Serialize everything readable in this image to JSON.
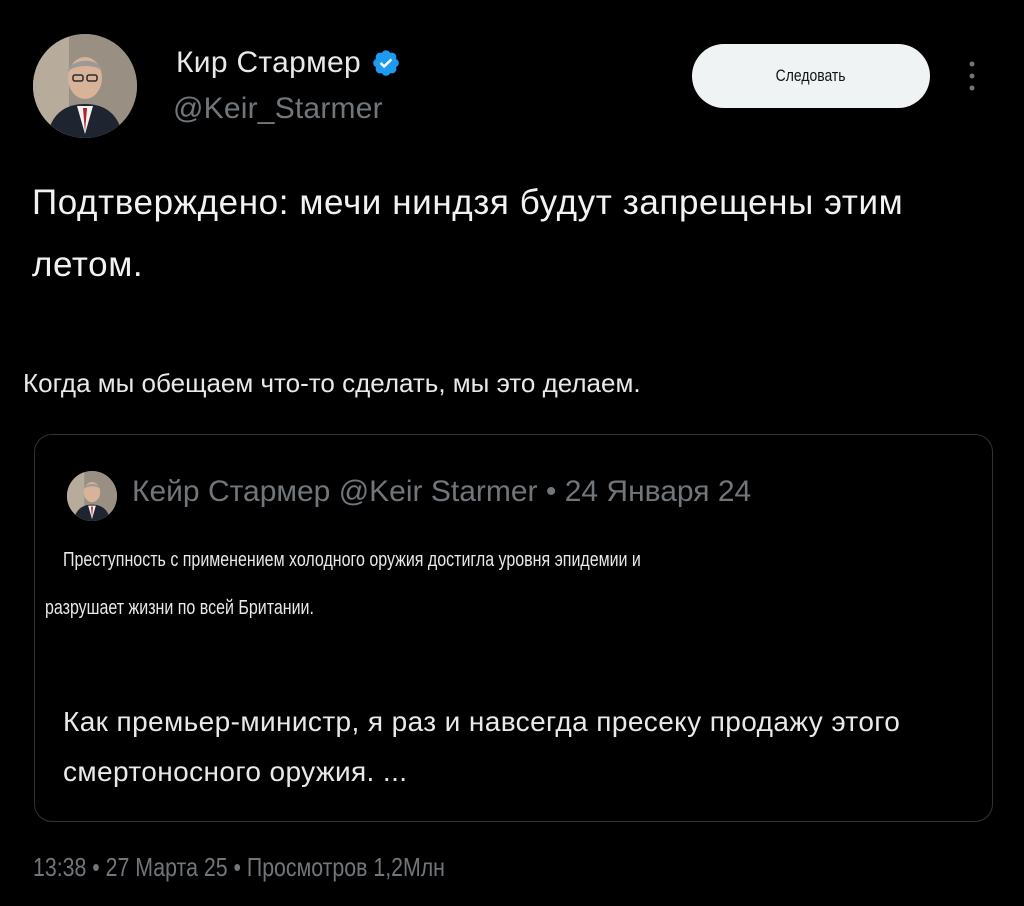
{
  "author": {
    "name": "Кир Стармер",
    "handle": "@Keir_Starmer",
    "avatar_icon": "portrait-avatar-icon",
    "verified_icon": "verified-badge-icon",
    "verified_color": "#1d9bf0"
  },
  "actions": {
    "follow_label": "Следовать",
    "more_icon": "more-vertical-icon"
  },
  "tweet": {
    "headline": "Подтверждено: мечи ниндзя будут запрещены этим летом.",
    "subtext": "Когда мы обещаем что-то сделать, мы это делаем."
  },
  "quoted": {
    "header": "Кейр Стармер @Keir Starmer • 24 Января 24",
    "line1": "Преступность с применением холодного оружия достигла уровня эпидемии и",
    "line2": "разрушает жизни по всей Британии.",
    "body": "Как премьер-министр, я раз и навсегда пресеку продажу этого смертоносного оружия. ..."
  },
  "meta": {
    "text": "13:38 • 27 Марта 25 • Просмотров 1,2Млн"
  },
  "colors": {
    "background": "#000000",
    "text_primary": "#e7e9ea",
    "text_secondary": "#71767b",
    "border": "#2f3336",
    "button_bg": "#eff3f4"
  }
}
